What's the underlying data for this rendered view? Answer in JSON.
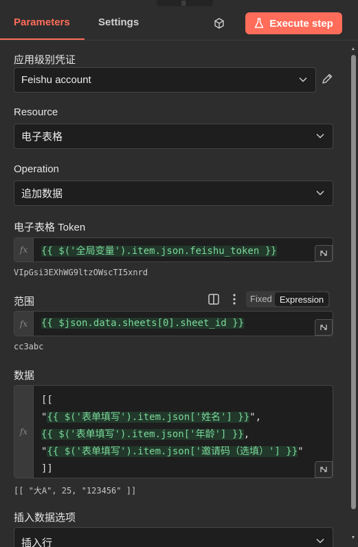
{
  "tabs": {
    "parameters": "Parameters",
    "settings": "Settings"
  },
  "execute_button": "Execute step",
  "credential": {
    "label": "应用级别凭证",
    "value": "Feishu account"
  },
  "resource": {
    "label": "Resource",
    "value": "电子表格"
  },
  "operation": {
    "label": "Operation",
    "value": "追加数据"
  },
  "token": {
    "label": "电子表格 Token",
    "expression": "{{ $('全局变量').item.json.feishu_token }}",
    "preview": "VIpGsi3EXhWG9ltzOWscTI5xnrd"
  },
  "range": {
    "label": "范围",
    "expression": "{{ $json.data.sheets[0].sheet_id }}",
    "preview": "cc3abc",
    "toggle_fixed": "Fixed",
    "toggle_expression": "Expression"
  },
  "data": {
    "label": "数据",
    "open": "[[",
    "line1_quote_open": "\"",
    "line1_expr": "{{ $('表单填写').item.json['姓名'] }}",
    "line1_tail": "\",",
    "line2_expr": "{{ $('表单填写').item.json['年龄'] }}",
    "line2_tail": ",",
    "line3_quote_open": "\"",
    "line3_expr": "{{ $('表单填写').item.json['邀请码（选填）'] }}",
    "line3_tail": "\"",
    "close": "]]",
    "preview": "[[ \"大A\", 25, \"123456\" ]]"
  },
  "insert_options": {
    "label": "插入数据选项",
    "value": "插入行"
  },
  "colors": {
    "accent": "#ff6d5a",
    "expression_highlight": "#7bd99a",
    "background": "#2d2d2d"
  }
}
